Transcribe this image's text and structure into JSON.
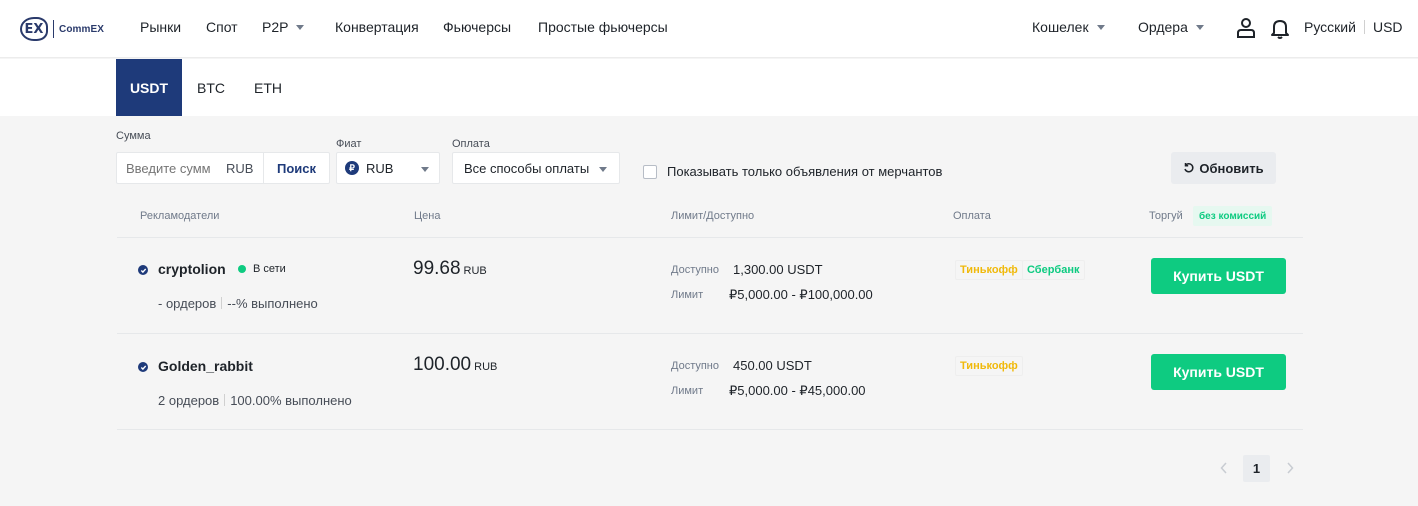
{
  "brand": {
    "logo_mark": "EX",
    "logo_text": "CommEX"
  },
  "nav": {
    "markets": "Рынки",
    "spot": "Спот",
    "p2p": "P2P",
    "convert": "Конвертация",
    "futures": "Фьючерсы",
    "simple_futures": "Простые фьючерсы",
    "wallet": "Кошелек",
    "orders": "Ордера",
    "language": "Русский",
    "currency": "USD"
  },
  "icons": {
    "user": "user-icon",
    "bell": "bell-icon",
    "caret": "chevron-down-icon",
    "refresh": "refresh-icon",
    "verified": "verified-check-icon"
  },
  "asset_tabs": [
    {
      "label": "USDT",
      "active": true
    },
    {
      "label": "BTC",
      "active": false
    },
    {
      "label": "ETH",
      "active": false
    }
  ],
  "filters": {
    "amount_label": "Сумма",
    "amount_placeholder": "Введите сумм",
    "amount_unit": "RUB",
    "search_button": "Поиск",
    "fiat_label": "Фиат",
    "fiat_badge": "₽",
    "fiat_value": "RUB",
    "payment_label": "Оплата",
    "payment_value": "Все способы оплаты",
    "merchant_only_label": "Показывать только объявления от мерчантов",
    "refresh_button": "Обновить"
  },
  "table": {
    "columns": {
      "advertisers": "Рекламодатели",
      "price": "Цена",
      "limit_available": "Лимит/Доступно",
      "payment": "Оплата",
      "trade": "Торгуй",
      "no_fee_badge": "без комиссий"
    },
    "available_label": "Доступно",
    "limit_label": "Лимит",
    "buy_label": "Купить USDT",
    "rows": [
      {
        "name": "cryptolion",
        "online_text": "В сети",
        "orders": "- ордеров",
        "completion": "--% выполнено",
        "price": "99.68",
        "price_currency": "RUB",
        "available": "1,300.00 USDT",
        "limit": "₽5,000.00 - ₽100,000.00",
        "payments": [
          {
            "name": "Тинькофф",
            "color": "#f0b90b"
          },
          {
            "name": "Сбербанк",
            "color": "#0ecb81"
          }
        ]
      },
      {
        "name": "Golden_rabbit",
        "orders": "2 ордеров",
        "completion": "100.00% выполнено",
        "price": "100.00",
        "price_currency": "RUB",
        "available": "450.00 USDT",
        "limit": "₽5,000.00 - ₽45,000.00",
        "payments": [
          {
            "name": "Тинькофф",
            "color": "#f0b90b"
          }
        ]
      }
    ]
  },
  "pagination": {
    "current_page": "1"
  },
  "colors": {
    "accent": "#1e3a7a",
    "buy": "#0ecb81",
    "tinkoff": "#f0b90b",
    "sber": "#0ecb81"
  }
}
